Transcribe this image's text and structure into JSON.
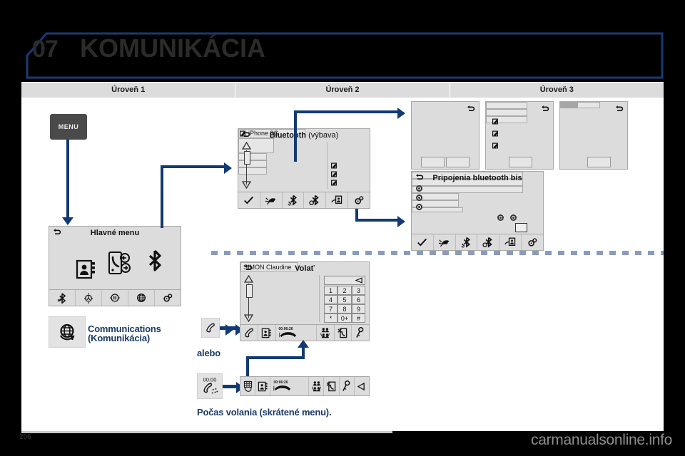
{
  "chapter": {
    "number": "07",
    "title": "KOMUNIKÁCIA"
  },
  "levels": [
    {
      "label": "Úroveň 1"
    },
    {
      "label": "Úroveň 2"
    },
    {
      "label": "Úroveň 3"
    }
  ],
  "hardware": {
    "menu_button_label": "MENU"
  },
  "screens": {
    "main_menu": {
      "title": "Hlavné menu",
      "back_icon": "back-arrow-icon",
      "icons": [
        "phonebook-icon",
        "call-transfer-icon",
        "bluetooth-icon"
      ],
      "softkeys": [
        "bluetooth-off-icon",
        "navigation-icon",
        "media-icon",
        "globe-icon",
        "settings-icon"
      ]
    },
    "bluetooth": {
      "title": "Bluetooth",
      "subtitle": "(výbava)",
      "back_icon": "back-arrow-icon",
      "device": "iPhone 3G",
      "softkeys": [
        "check-icon",
        "disconnect-icon",
        "pair-icon",
        "unpair-icon",
        "device-icon",
        "settings-icon"
      ]
    },
    "bt_connections": {
      "title": "Pripojenia bluetooth bis",
      "back_icon": "back-arrow-icon",
      "softkeys": [
        "check-icon",
        "disconnect-icon",
        "pair-icon",
        "unpair-icon",
        "device-icon",
        "settings-icon"
      ]
    },
    "call": {
      "title": "Volať",
      "back_icon": "back-arrow-icon",
      "contact": "SIMON Claudine",
      "keypad": [
        "1",
        "2",
        "3",
        "4",
        "5",
        "6",
        "7",
        "8",
        "9",
        "*",
        "0+",
        "#"
      ],
      "softkeys": [
        "handset-icon",
        "phonebook-icon",
        "hangup-icon",
        "",
        "transfer-icon",
        "mute-icon",
        "mic-icon"
      ],
      "call_timer": "00:06:26"
    },
    "in_call": {
      "softkeys": [
        "keypad-icon",
        "phonebook-icon",
        "hangup-icon",
        "",
        "transfer-icon",
        "mute-icon",
        "mic-icon",
        "back-triangle-icon"
      ],
      "call_timer": "00:06:26"
    },
    "level3_a": {
      "back_icon": "back-arrow-icon"
    },
    "level3_b": {
      "back_icon": "back-arrow-icon"
    },
    "level3_c": {
      "back_icon": "back-arrow-icon"
    }
  },
  "labels": {
    "communications_line1": "Communications",
    "communications_line2": "(Komunikácia)",
    "alebo": "alebo",
    "during_call": "Počas volania (skrátené menu).",
    "clock_tile": "00:00"
  },
  "footer": {
    "page_number": "206",
    "watermark": "carmanualsonline.info"
  },
  "colors": {
    "accent": "#123a73",
    "header_outline": "#1b3a73",
    "screen_bg": "#dcdcdc",
    "label_blue": "#1b3a66"
  }
}
